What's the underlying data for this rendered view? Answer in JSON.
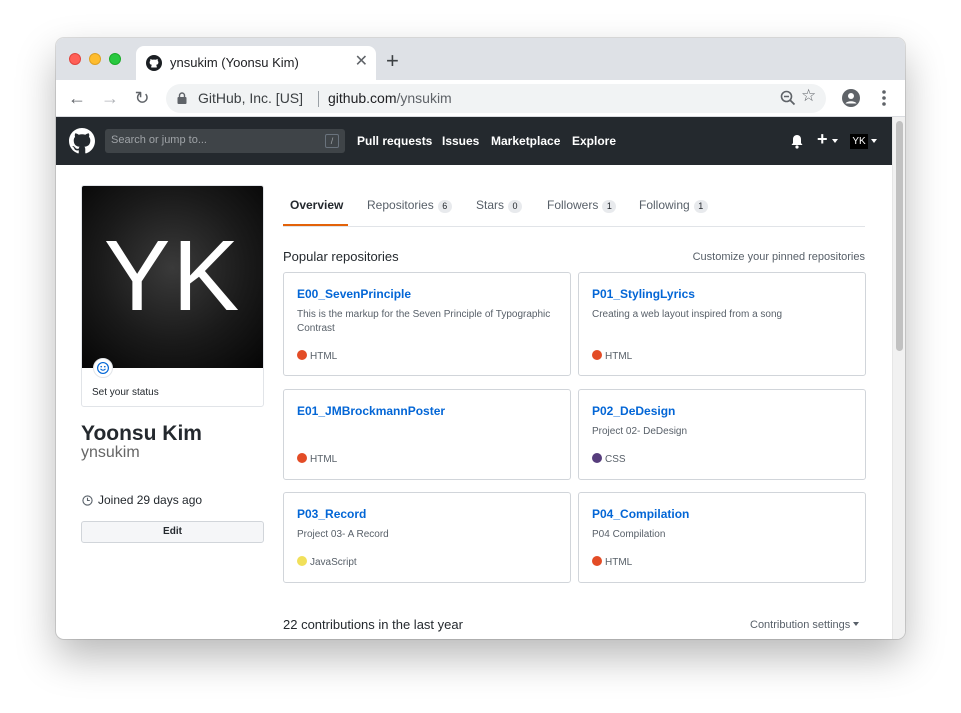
{
  "browser": {
    "tab_title": "ynsukim (Yoonsu Kim)",
    "tab_close": "✕",
    "new_tab": "+",
    "back": "←",
    "forward": "→",
    "reload": "↻",
    "cert_label": "GitHub, Inc. [US]",
    "url_host": "github.com",
    "url_path": "/ynsukim",
    "star": "☆"
  },
  "gh_header": {
    "search_placeholder": "Search or jump to...",
    "search_shortcut": "/",
    "nav": [
      "Pull requests",
      "Issues",
      "Marketplace",
      "Explore"
    ],
    "plus": "+",
    "avatar_initials": "YK"
  },
  "profile": {
    "avatar_initials": "YK",
    "status_label": "Set your status",
    "full_name": "Yoonsu Kim",
    "username": "ynsukim",
    "joined": "Joined 29 days ago",
    "edit_label": "Edit"
  },
  "tabs": [
    {
      "label": "Overview",
      "count": ""
    },
    {
      "label": "Repositories",
      "count": "6"
    },
    {
      "label": "Stars",
      "count": "0"
    },
    {
      "label": "Followers",
      "count": "1"
    },
    {
      "label": "Following",
      "count": "1"
    }
  ],
  "popular": {
    "title": "Popular repositories",
    "customize": "Customize your pinned repositories",
    "repos": [
      {
        "name": "E00_SevenPrinciple",
        "desc": "This is the markup for the Seven Principle of Typographic Contrast",
        "lang": "HTML",
        "color": "#e34c26"
      },
      {
        "name": "P01_StylingLyrics",
        "desc": "Creating a web layout inspired from a song",
        "lang": "HTML",
        "color": "#e34c26"
      },
      {
        "name": "E01_JMBrockmannPoster",
        "desc": "",
        "lang": "HTML",
        "color": "#e34c26"
      },
      {
        "name": "P02_DeDesign",
        "desc": "Project 02- DeDesign",
        "lang": "CSS",
        "color": "#563d7c"
      },
      {
        "name": "P03_Record",
        "desc": "Project 03- A Record",
        "lang": "JavaScript",
        "color": "#f1e05a"
      },
      {
        "name": "P04_Compilation",
        "desc": "P04 Compilation",
        "lang": "HTML",
        "color": "#e34c26"
      }
    ]
  },
  "contributions": {
    "title": "22 contributions in the last year",
    "settings": "Contribution settings"
  }
}
